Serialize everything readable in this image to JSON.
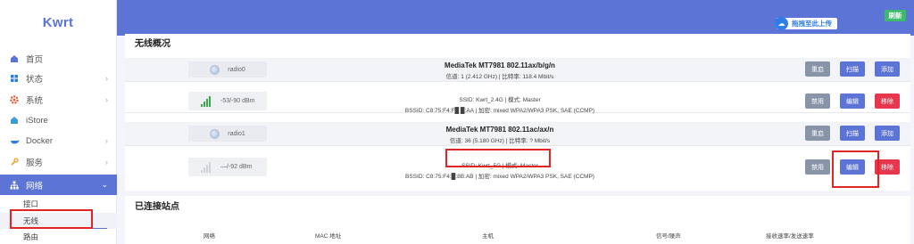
{
  "sidebar": {
    "logo": "Kwrt",
    "items": [
      {
        "label": "首页",
        "icon": "home-icon",
        "chevron": ""
      },
      {
        "label": "状态",
        "icon": "status-icon",
        "chevron": "›"
      },
      {
        "label": "系统",
        "icon": "gear-icon",
        "chevron": "›"
      },
      {
        "label": "iStore",
        "icon": "store-icon",
        "chevron": ""
      },
      {
        "label": "Docker",
        "icon": "docker-icon",
        "chevron": "›"
      },
      {
        "label": "服务",
        "icon": "services-icon",
        "chevron": "›"
      },
      {
        "label": "网络",
        "icon": "network-icon",
        "chevron": "⌄"
      }
    ],
    "sub_items": [
      "接口",
      "无线",
      "路由"
    ]
  },
  "header": {
    "upload_label": "拖拽至此上传",
    "refresh_label": "刷新"
  },
  "wireless": {
    "title": "无线概况",
    "radios": [
      {
        "device": "radio0",
        "model": "MediaTek MT7981 802.11ax/b/g/n",
        "channel_line": "信道: 1 (2.412 GHz) | 比特率: 118.4 Mbit/s",
        "buttons": [
          "重启",
          "扫描",
          "添加"
        ],
        "network": {
          "signal": "-53/-90 dBm",
          "ssid_line": "SSID: Kwrt_2.4G | 模式: Master",
          "bssid_line": "BSSID: C8:75:F4:F█ █:AA | 加密: mixed WPA2/WPA3 PSK, SAE (CCMP)",
          "buttons": [
            "禁用",
            "编辑",
            "移除"
          ]
        }
      },
      {
        "device": "radio1",
        "model": "MediaTek MT7981 802.11ac/ax/n",
        "channel_line": "信道: 36 (5.180 GHz) | 比特率: ? Mbit/s",
        "buttons": [
          "重启",
          "扫描",
          "添加"
        ],
        "network": {
          "signal": "—/-92 dBm",
          "ssid_line": "SSID: Kwrt_5G | 模式: Master",
          "bssid_line": "BSSID: C8:75:F4:█:8B:AB | 加密: mixed WPA2/WPA3 PSK, SAE (CCMP)",
          "buttons": [
            "禁用",
            "编辑",
            "移除"
          ]
        }
      }
    ]
  },
  "stations": {
    "title": "已连接站点",
    "columns": [
      "网络",
      "MAC 地址",
      "主机",
      "信号/噪声",
      "接收速率/发送速率"
    ]
  },
  "colors": {
    "accent": "#5c74d6",
    "danger": "#e8364e",
    "neutral_button": "#8a94a8",
    "success": "#3dbb6a",
    "highlight": "#e22424"
  }
}
